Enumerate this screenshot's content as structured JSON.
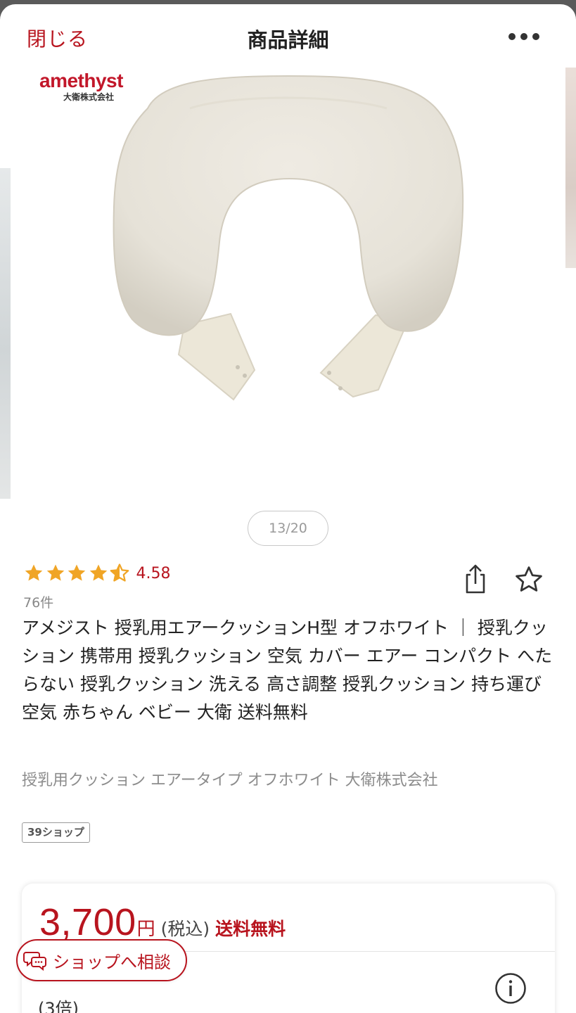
{
  "header": {
    "close_label": "閉じる",
    "title": "商品詳細",
    "more_icon": "more-dots-icon"
  },
  "gallery": {
    "brand_name": "amethyst",
    "brand_sub": "大衛株式会社",
    "page_indicator": "13/20"
  },
  "rating": {
    "value": "4.58",
    "stars": 4.58,
    "count": "76件",
    "color": "#f0a526"
  },
  "product": {
    "title": "アメジスト 授乳用エアークッションH型 オフホワイト ｜ 授乳クッション 携帯用 授乳クッション 空気 カバー エアー コンパクト へたらない 授乳クッション 洗える 高さ調整 授乳クッション 持ち運び 空気 赤ちゃん ベビー 大衛 送料無料",
    "subtitle": "授乳用クッション エアータイプ オフホワイト 大衛株式会社",
    "shop_badge": "39ショップ"
  },
  "price": {
    "amount": "3,700",
    "yen": "円",
    "tax": "(税込)",
    "shipping": "送料無料",
    "points": "(3倍)"
  },
  "consult": {
    "label": "ショップへ相談"
  },
  "colors": {
    "accent": "#b8141e",
    "star": "#f0a526"
  }
}
